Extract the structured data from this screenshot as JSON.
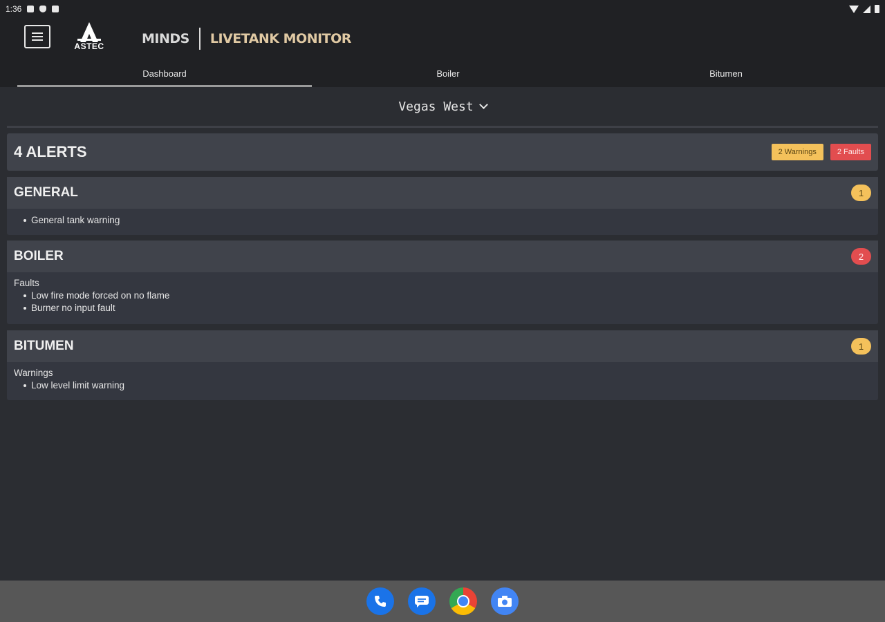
{
  "status_bar": {
    "time": "1:36"
  },
  "app_bar": {
    "logo_text": "ASTEC",
    "brand_primary": "MINDS",
    "brand_secondary": "LIVETANK MONITOR"
  },
  "tabs": [
    {
      "label": "Dashboard",
      "active": true
    },
    {
      "label": "Boiler",
      "active": false
    },
    {
      "label": "Bitumen",
      "active": false
    }
  ],
  "location_selector": {
    "value": "Vegas West"
  },
  "alerts": {
    "title": "4 ALERTS",
    "warnings_badge": "2 Warnings",
    "faults_badge": "2 Faults"
  },
  "sections": {
    "general": {
      "title": "GENERAL",
      "count": "1",
      "items": [
        "General tank warning"
      ]
    },
    "boiler": {
      "title": "BOILER",
      "count": "2",
      "group_label": "Faults",
      "items": [
        "Low fire mode forced on no flame",
        "Burner no input fault"
      ]
    },
    "bitumen": {
      "title": "BITUMEN",
      "count": "1",
      "group_label": "Warnings",
      "items": [
        "Low level limit warning"
      ]
    }
  },
  "colors": {
    "warning": "#f4c15b",
    "fault": "#e24d4f",
    "brand_accent": "#e0c9a3"
  },
  "dock": {
    "apps": [
      "phone-icon",
      "messages-icon",
      "chrome-icon",
      "camera-icon"
    ]
  }
}
